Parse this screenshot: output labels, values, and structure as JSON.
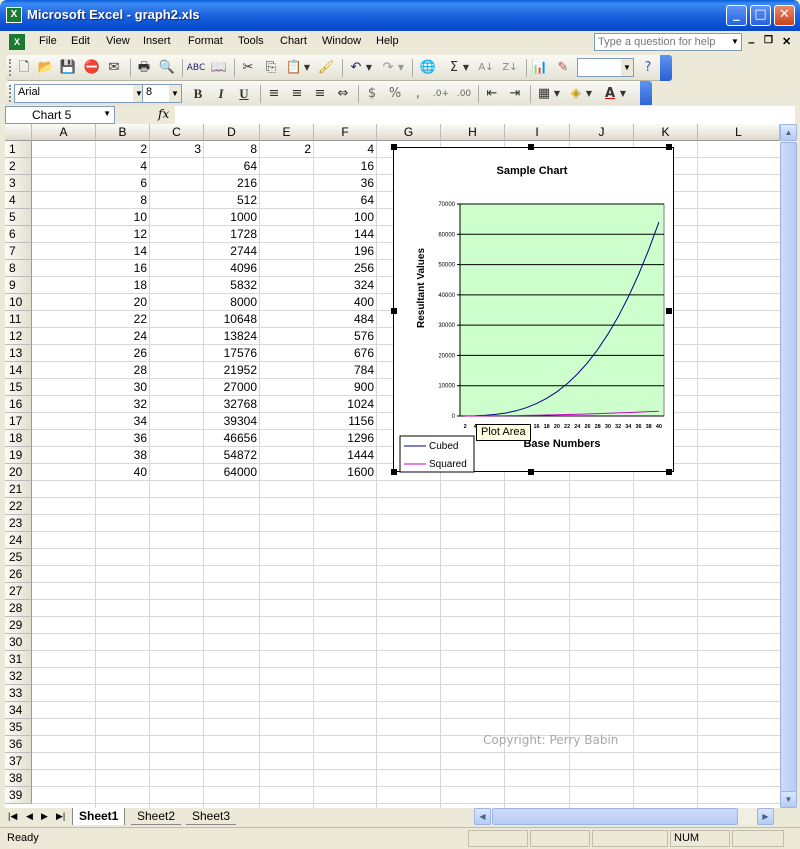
{
  "window": {
    "title": "Microsoft Excel - graph2.xls",
    "app_icon": "excel-icon",
    "controls": [
      "minimize-icon",
      "maximize-icon",
      "close-icon"
    ]
  },
  "menu": {
    "items": [
      "File",
      "Edit",
      "View",
      "Insert",
      "Format",
      "Tools",
      "Chart",
      "Window",
      "Help"
    ],
    "help_placeholder": "Type a question for help"
  },
  "formatting": {
    "font": "Arial",
    "size": "8",
    "bold": "B",
    "italic": "I",
    "underline": "U",
    "currency": "$",
    "percent": "%"
  },
  "formula_bar": {
    "name_box": "Chart 5",
    "fx": "fx",
    "value": ""
  },
  "grid": {
    "columns": [
      "A",
      "B",
      "C",
      "D",
      "E",
      "F",
      "G",
      "H",
      "I",
      "J",
      "K",
      "L"
    ],
    "rows": [
      "1",
      "2",
      "3",
      "4",
      "5",
      "6",
      "7",
      "8",
      "9",
      "10",
      "11",
      "12",
      "13",
      "14",
      "15",
      "16",
      "17",
      "18",
      "19",
      "20",
      "21",
      "22",
      "23",
      "24",
      "25",
      "26",
      "27",
      "28",
      "29",
      "30",
      "31",
      "32",
      "33",
      "34",
      "35",
      "36",
      "37",
      "38",
      "39"
    ],
    "row1": {
      "B": "2",
      "C": "3",
      "D": "8",
      "E": "2",
      "F": "4"
    },
    "col_b": [
      "2",
      "4",
      "6",
      "8",
      "10",
      "12",
      "14",
      "16",
      "18",
      "20",
      "22",
      "24",
      "26",
      "28",
      "30",
      "32",
      "34",
      "36",
      "38",
      "40"
    ],
    "col_d": [
      "8",
      "64",
      "216",
      "512",
      "1000",
      "1728",
      "2744",
      "4096",
      "5832",
      "8000",
      "10648",
      "13824",
      "17576",
      "21952",
      "27000",
      "32768",
      "39304",
      "46656",
      "54872",
      "64000"
    ],
    "col_f": [
      "4",
      "16",
      "36",
      "64",
      "100",
      "144",
      "196",
      "256",
      "324",
      "400",
      "484",
      "576",
      "676",
      "784",
      "900",
      "1024",
      "1156",
      "1296",
      "1444",
      "1600"
    ]
  },
  "chart_data": {
    "type": "line",
    "title": "Sample Chart",
    "xlabel": "Base Numbers",
    "ylabel": "Resultant Values",
    "categories": [
      2,
      4,
      6,
      8,
      10,
      12,
      14,
      16,
      18,
      20,
      22,
      24,
      26,
      28,
      30,
      32,
      34,
      36,
      38,
      40
    ],
    "x_tick_labels": [
      "2",
      "4",
      "6",
      "8",
      "10",
      "12",
      "14",
      "16",
      "18",
      "20",
      "22",
      "24",
      "26",
      "28",
      "30",
      "32",
      "34",
      "36",
      "38",
      "40"
    ],
    "y_ticks": [
      "0",
      "10000",
      "20000",
      "30000",
      "40000",
      "50000",
      "60000",
      "70000"
    ],
    "ylim": [
      0,
      70000
    ],
    "grid": true,
    "legend_position": "bottom-left",
    "plot_area_color": "#ccffcc",
    "series": [
      {
        "name": "Cubed",
        "color": "#000080",
        "values": [
          8,
          64,
          216,
          512,
          1000,
          1728,
          2744,
          4096,
          5832,
          8000,
          10648,
          13824,
          17576,
          21952,
          27000,
          32768,
          39304,
          46656,
          54872,
          64000
        ]
      },
      {
        "name": "Squared",
        "color": "#cc00cc",
        "values": [
          4,
          16,
          36,
          64,
          100,
          144,
          196,
          256,
          324,
          400,
          484,
          576,
          676,
          784,
          900,
          1024,
          1156,
          1296,
          1444,
          1600
        ]
      }
    ]
  },
  "tooltip": "Plot Area",
  "copyright": "Copyright: Perry Babin",
  "sheets": {
    "tabs": [
      "Sheet1",
      "Sheet2",
      "Sheet3"
    ],
    "active": "Sheet1"
  },
  "status": {
    "text": "Ready",
    "num": "NUM"
  }
}
